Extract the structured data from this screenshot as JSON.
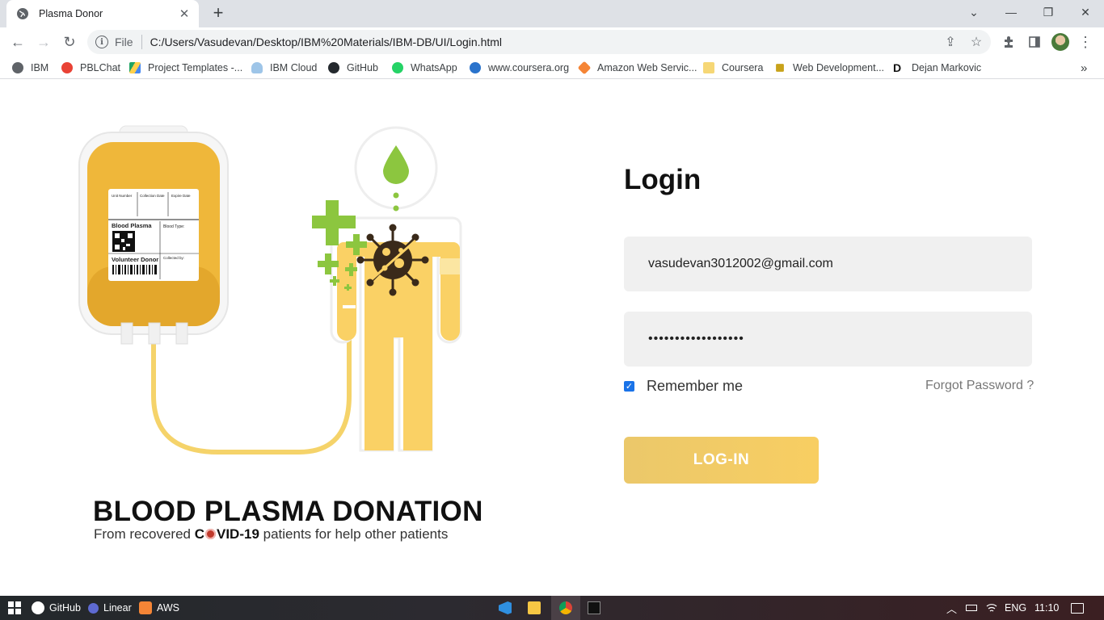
{
  "browser": {
    "tab_title": "Plasma Donor",
    "tab_close": "✕",
    "new_tab": "+",
    "url_scheme": "File",
    "url": "C:/Users/Vasudevan/Desktop/IBM%20Materials/IBM-DB/UI/Login.html",
    "bookmarks": [
      {
        "label": "IBM",
        "icon": "globe-icon",
        "color": "#5f6368"
      },
      {
        "label": "PBLChat",
        "icon": "pblchat-icon",
        "color": "#e94235"
      },
      {
        "label": "Project Templates -...",
        "icon": "google-drive-icon",
        "color": "#1fa463"
      },
      {
        "label": "IBM Cloud",
        "icon": "cloud-icon",
        "color": "#9ec5e8"
      },
      {
        "label": "GitHub",
        "icon": "github-icon",
        "color": "#24292e"
      },
      {
        "label": "WhatsApp",
        "icon": "whatsapp-icon",
        "color": "#25d366"
      },
      {
        "label": "www.coursera.org",
        "icon": "coursera-icon",
        "color": "#2a73cc"
      },
      {
        "label": "Amazon Web Servic...",
        "icon": "aws-icon",
        "color": "#f58536"
      },
      {
        "label": "Coursera",
        "icon": "folder-icon",
        "color": "#f6d776"
      },
      {
        "label": "Web Development...",
        "icon": "web-dev-icon",
        "color": "#c8a21a"
      },
      {
        "label": "Dejan Markovic",
        "icon": "d-letter-icon",
        "color": "#111111"
      }
    ],
    "bookmarks_more": "»"
  },
  "hero": {
    "title": "BLOOD PLASMA DONATION",
    "subtitle_prefix": "From recovered ",
    "subtitle_bold_a": "C",
    "subtitle_bold_b": "VID-19",
    "subtitle_suffix": " patients for help other patients",
    "bag_label": {
      "unit_number": "Unit Number",
      "collection_date": "Collection Date",
      "expire_date": "Expire Date",
      "blood_plasma": "Blood Plasma",
      "blood_type": "Blood Type:",
      "volunteer_donor": "Volunteer Donor",
      "collected_by": "Collected by:"
    }
  },
  "login": {
    "title": "Login",
    "email_value": "vasudevan3012002@gmail.com",
    "password_value": "••••••••••••••••••",
    "remember_label": "Remember me",
    "remember_checked": true,
    "forgot_label": "Forgot Password ?",
    "button_label": "LOG-IN",
    "colors": {
      "button": "#f4cc64",
      "field_bg": "#f0f0f0",
      "plasma": "#f3bf3d"
    }
  },
  "taskbar": {
    "items": [
      {
        "label": "GitHub",
        "icon": "github-icon"
      },
      {
        "label": "Linear",
        "icon": "linear-icon"
      },
      {
        "label": "AWS",
        "icon": "aws-icon"
      }
    ],
    "pinned": [
      "vscode-icon",
      "file-explorer-icon",
      "chrome-icon",
      "terminal-icon"
    ],
    "language": "ENG",
    "time": "11:10"
  }
}
